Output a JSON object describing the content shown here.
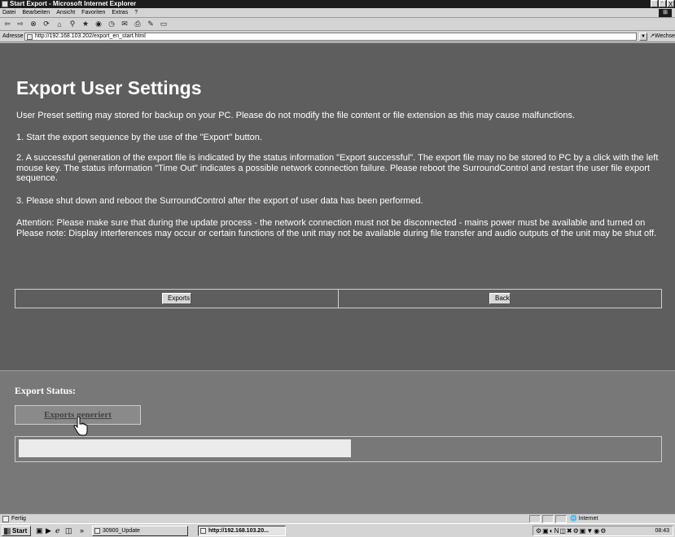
{
  "window": {
    "title": "Start Export - Microsoft Internet Explorer",
    "minimize": "_",
    "maximize": "´",
    "close": "X"
  },
  "menu": {
    "items": [
      "Datei",
      "Bearbeiten",
      "Ansicht",
      "Favoriten",
      "Extras",
      "?"
    ]
  },
  "address": {
    "label": "Adresse",
    "url": "http://192.168.103.202/export_en_start.html",
    "go_label": "Wechseln zu"
  },
  "page": {
    "title": "Export User Settings",
    "paragraphs": [
      "User Preset setting may stored for backup on your PC. Please do not modify the file content or file extension as this may cause malfunctions.",
      "1. Start the export sequence by the use of the \"Export\" button.",
      "2. A successful generation of the export file is indicated by the status information \"Export successful\". The export file may no be stored to PC by a click with the left mouse key. The status information \"Time Out\" indicates a possible network connection failure. Please reboot the SurroundControl and restart the user file export sequence.",
      "3. Please shut down and reboot the SurroundControl after the export of user data has been performed.",
      "Attention: Please make sure that during the update process - the network connection must not be disconnected - mains power must be available and turned on Please note: Display interferences may occur or certain functions of the unit may not be available during file transfer and audio outputs of the unit may be shut off."
    ],
    "exports_button": "Exports",
    "back_button": "Back",
    "status_label": "Export Status:",
    "status_link": "Exports generiert",
    "progress_fraction": 0.52
  },
  "statusbar": {
    "text": "Fertig",
    "zone": "Internet"
  },
  "taskbar": {
    "start": "Start",
    "chevron": "»",
    "tasks": [
      {
        "label": "30900_Update",
        "active": false
      },
      {
        "label": "http://192.168.103.20...",
        "active": true
      }
    ],
    "clock": "08:43"
  },
  "colors": {
    "content_bg": "#5e5e5e",
    "lower_bg": "#787878",
    "text": "#ffffff"
  }
}
